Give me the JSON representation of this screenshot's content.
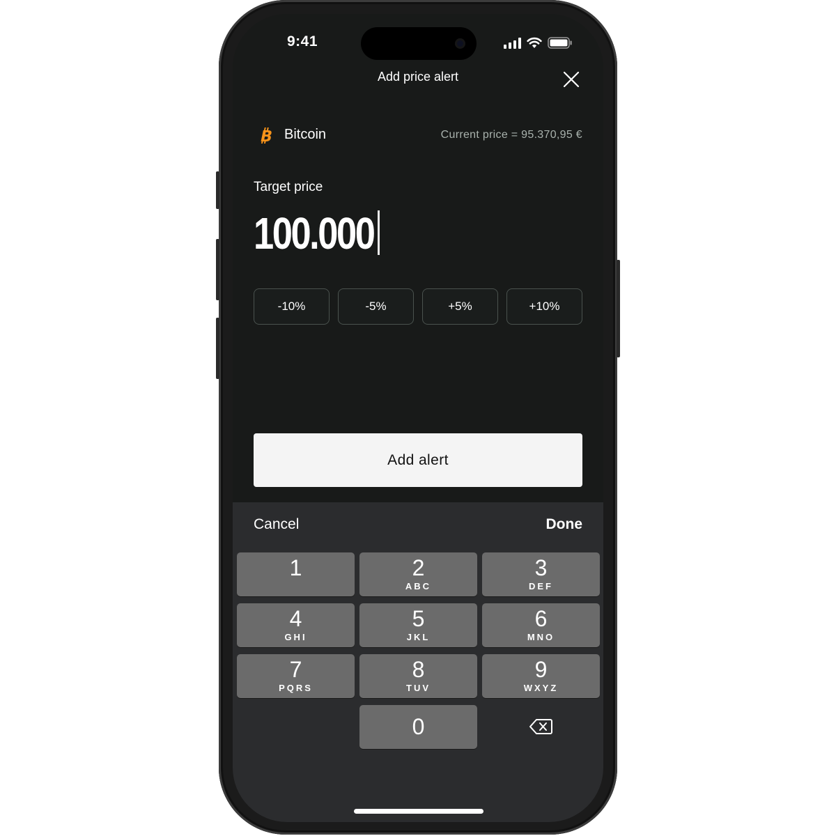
{
  "status_bar": {
    "time": "9:41"
  },
  "header": {
    "title": "Add price alert"
  },
  "asset": {
    "name": "Bitcoin",
    "current_price": "Current price = 95.370,95 €",
    "brand_color": "#f7931a"
  },
  "target": {
    "label": "Target price",
    "value": "100.000"
  },
  "adjust_buttons": [
    "-10%",
    "-5%",
    "+5%",
    "+10%"
  ],
  "primary_action": {
    "label": "Add alert"
  },
  "keyboard": {
    "cancel_label": "Cancel",
    "done_label": "Done",
    "keys": [
      {
        "num": "1",
        "letters": ""
      },
      {
        "num": "2",
        "letters": "ABC"
      },
      {
        "num": "3",
        "letters": "DEF"
      },
      {
        "num": "4",
        "letters": "GHI"
      },
      {
        "num": "5",
        "letters": "JKL"
      },
      {
        "num": "6",
        "letters": "MNO"
      },
      {
        "num": "7",
        "letters": "PQRS"
      },
      {
        "num": "8",
        "letters": "TUV"
      },
      {
        "num": "9",
        "letters": "WXYZ"
      },
      {
        "num": "0",
        "letters": ""
      }
    ]
  },
  "icons": {
    "close": "close-icon",
    "asset": "bitcoin-icon",
    "backspace": "backspace-icon",
    "signal": "cellular-signal-icon",
    "wifi": "wifi-icon",
    "battery": "battery-icon"
  }
}
